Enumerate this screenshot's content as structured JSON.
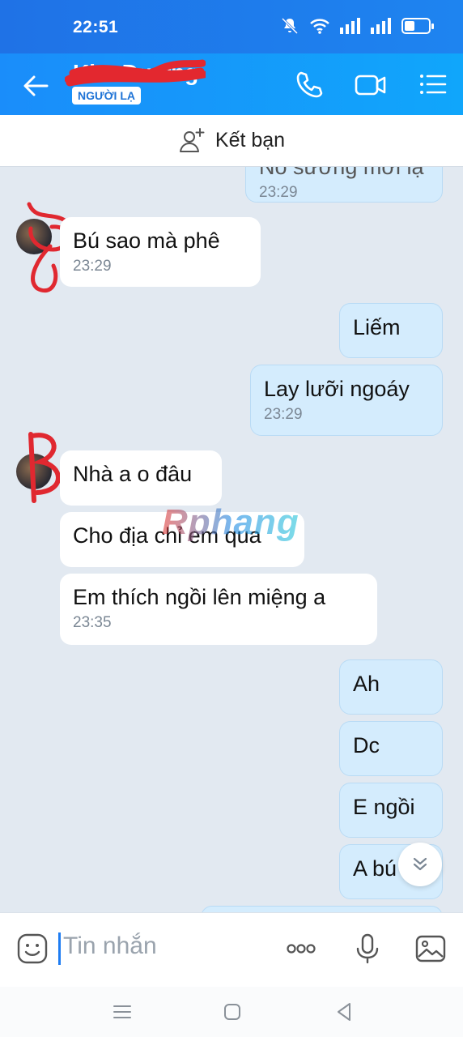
{
  "status_bar": {
    "time": "22:51"
  },
  "header": {
    "contact_name": "Kim Dương",
    "stranger_badge": "NGƯỜI LẠ"
  },
  "add_friend": {
    "label": "Kết bạn"
  },
  "messages": [
    {
      "side": "out",
      "text": "Nó sướng mới lạ",
      "time": "23:29"
    },
    {
      "side": "in",
      "text": "Bú sao mà phê",
      "time": "23:29"
    },
    {
      "side": "out",
      "text": "Liếm",
      "time": ""
    },
    {
      "side": "out",
      "text": "Lay lưỡi ngoáy",
      "time": "23:29"
    },
    {
      "side": "in",
      "text": "Nhà a o đâu",
      "time": ""
    },
    {
      "side": "in",
      "text": "Cho địa chỉ em qua",
      "time": ""
    },
    {
      "side": "in",
      "text": "Em thích ngồi lên miệng a",
      "time": "23:35"
    },
    {
      "side": "out",
      "text": "Ah",
      "time": ""
    },
    {
      "side": "out",
      "text": "Dc",
      "time": ""
    },
    {
      "side": "out",
      "text": "E ngồi",
      "time": ""
    },
    {
      "side": "out",
      "text": "A bú",
      "time": ""
    }
  ],
  "watermark": "Rphang",
  "composer": {
    "placeholder": "Tin nhắn"
  },
  "colors": {
    "accent": "#1e88f5",
    "out_bubble": "#d4ecfd",
    "in_bubble": "#ffffff",
    "chat_bg": "#e2e9f1"
  }
}
